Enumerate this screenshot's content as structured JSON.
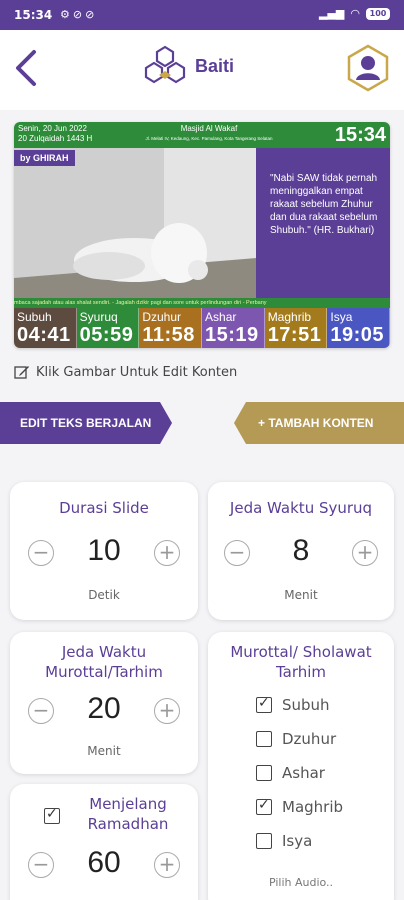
{
  "status": {
    "time": "15:34",
    "battery": "100"
  },
  "header": {
    "brand": "Baiti"
  },
  "preview": {
    "date_line1": "Senin, 20 Jun 2022",
    "date_line2": "20 Zulqaidah 1443 H",
    "mosque": "Masjid Al Wakaf",
    "address": "Jl. Melati IV, Kedaung, Kec. Pamulang, Kota Tangerang Selatan",
    "clock": "15:34",
    "by": "by GHIRAH",
    "quote": "\"Nabi SAW tidak pernah meninggalkan empat rakaat sebelum Zhuhur dan dua rakaat sebelum Shubuh.\" (HR. Bukhari)",
    "ticker": "mbaca sajadah atau alas shalat sendiri. - Jagalah dzikir pagi dan sore untuk perlindungan diri - Perbany",
    "prayers": [
      {
        "name": "Subuh",
        "time": "04:41",
        "color": "#5d4b3f"
      },
      {
        "name": "Syuruq",
        "time": "05:59",
        "color": "#2e8b3a"
      },
      {
        "name": "Dzuhur",
        "time": "11:58",
        "color": "#a8701f"
      },
      {
        "name": "Ashar",
        "time": "15:19",
        "color": "#7d56b0"
      },
      {
        "name": "Maghrib",
        "time": "17:51",
        "color": "#a37b1c"
      },
      {
        "name": "Isya",
        "time": "19:05",
        "color": "#4a56c2"
      }
    ]
  },
  "edit_hint": "Klik Gambar Untuk Edit Konten",
  "actions": {
    "edit_ticker": "EDIT TEKS BERJALAN",
    "add_content": "+ TAMBAH KONTEN"
  },
  "cards": {
    "slide": {
      "title": "Durasi Slide",
      "value": "10",
      "unit": "Detik"
    },
    "syuruq": {
      "title": "Jeda Waktu Syuruq",
      "value": "8",
      "unit": "Menit"
    },
    "murottal": {
      "title": "Jeda Waktu Murottal/Tarhim",
      "value": "20",
      "unit": "Menit"
    },
    "tarhim": {
      "title": "Murottal/ Sholawat Tarhim",
      "options": [
        {
          "label": "Subuh",
          "checked": true
        },
        {
          "label": "Dzuhur",
          "checked": false
        },
        {
          "label": "Ashar",
          "checked": false
        },
        {
          "label": "Maghrib",
          "checked": true
        },
        {
          "label": "Isya",
          "checked": false
        }
      ],
      "audio_label": "Pilih Audio.."
    },
    "ramadhan": {
      "title": "Menjelang Ramadhan",
      "checked": true,
      "value": "60"
    }
  },
  "colors": {
    "primary": "#5b3f97",
    "gold": "#b59a56",
    "green": "#2e8b3a"
  }
}
